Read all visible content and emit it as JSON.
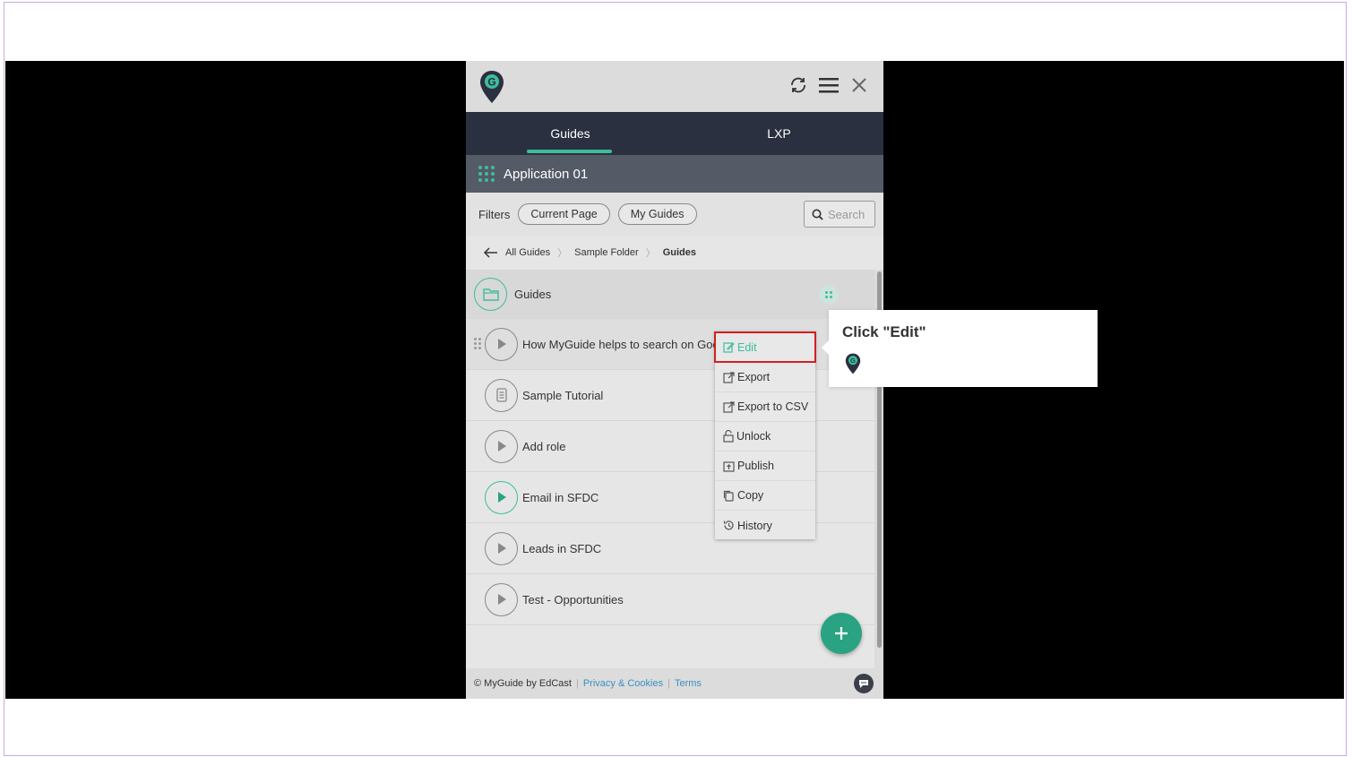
{
  "header": {
    "icons": [
      "location-logo-icon",
      "refresh-icon",
      "hamburger-menu-icon",
      "close-icon"
    ]
  },
  "tabs": [
    {
      "label": "Guides",
      "active": true
    },
    {
      "label": "LXP",
      "active": false
    }
  ],
  "app": {
    "label": "Application 01"
  },
  "filters": {
    "label": "Filters",
    "chips": [
      "Current Page",
      "My Guides"
    ],
    "search_placeholder": "Search"
  },
  "breadcrumb": {
    "items": [
      "All Guides",
      "Sample Folder",
      "Guides"
    ]
  },
  "folder": {
    "label": "Guides"
  },
  "guides": [
    {
      "label": "How MyGuide helps to search on Googl",
      "icon": "play-icon"
    },
    {
      "label": "Sample Tutorial",
      "icon": "tutorial-icon"
    },
    {
      "label": "Add role",
      "icon": "play-icon"
    },
    {
      "label": "Email in SFDC",
      "icon": "play-icon-green"
    },
    {
      "label": "Leads in SFDC",
      "icon": "play-icon"
    },
    {
      "label": "Test - Opportunities",
      "icon": "play-icon"
    }
  ],
  "context_menu": {
    "items": [
      "Edit",
      "Export",
      "Export to CSV",
      "Unlock",
      "Publish",
      "Copy",
      "History"
    ]
  },
  "tooltip": {
    "text": "Click \"Edit\""
  },
  "footer": {
    "copyright": "© MyGuide by EdCast",
    "privacy": "Privacy & Cookies",
    "terms": "Terms"
  },
  "colors": {
    "accent": "#3dbd9c",
    "dark_tab": "#2b3040",
    "highlight": "#d32020"
  }
}
